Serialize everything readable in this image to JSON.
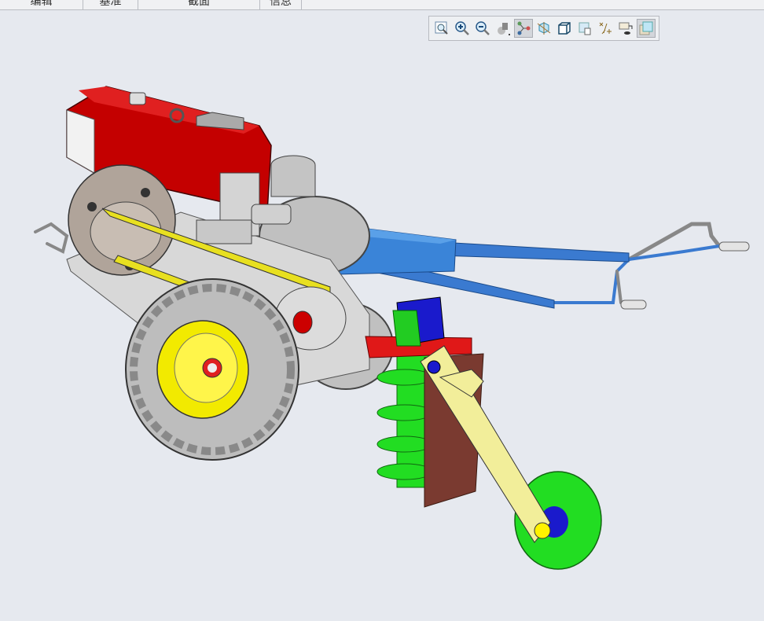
{
  "ribbon": {
    "tabs": [
      "编辑",
      "基准",
      "截面",
      "信息"
    ]
  },
  "view_toolbar": {
    "icons": [
      "refit-icon",
      "zoom-in-icon",
      "zoom-out-icon",
      "display-style-icon",
      "annotation-display-icon",
      "spin-center-icon",
      "saved-views-icon",
      "view-manager-icon",
      "datum-display-icon",
      "appearance-icon",
      "perspective-icon"
    ],
    "active": [
      "annotation-display-icon",
      "perspective-icon"
    ]
  },
  "model": {
    "colors": {
      "engine": "#c40000",
      "frame": "#3a82d4",
      "tire": "#c8c8c8",
      "rim": "#f0e800",
      "auger": "#22dd22",
      "arm": "#f2ee9a",
      "plate": "#7a3a30",
      "bracket": "#1a1acc",
      "background": "#e6e9ef"
    }
  }
}
